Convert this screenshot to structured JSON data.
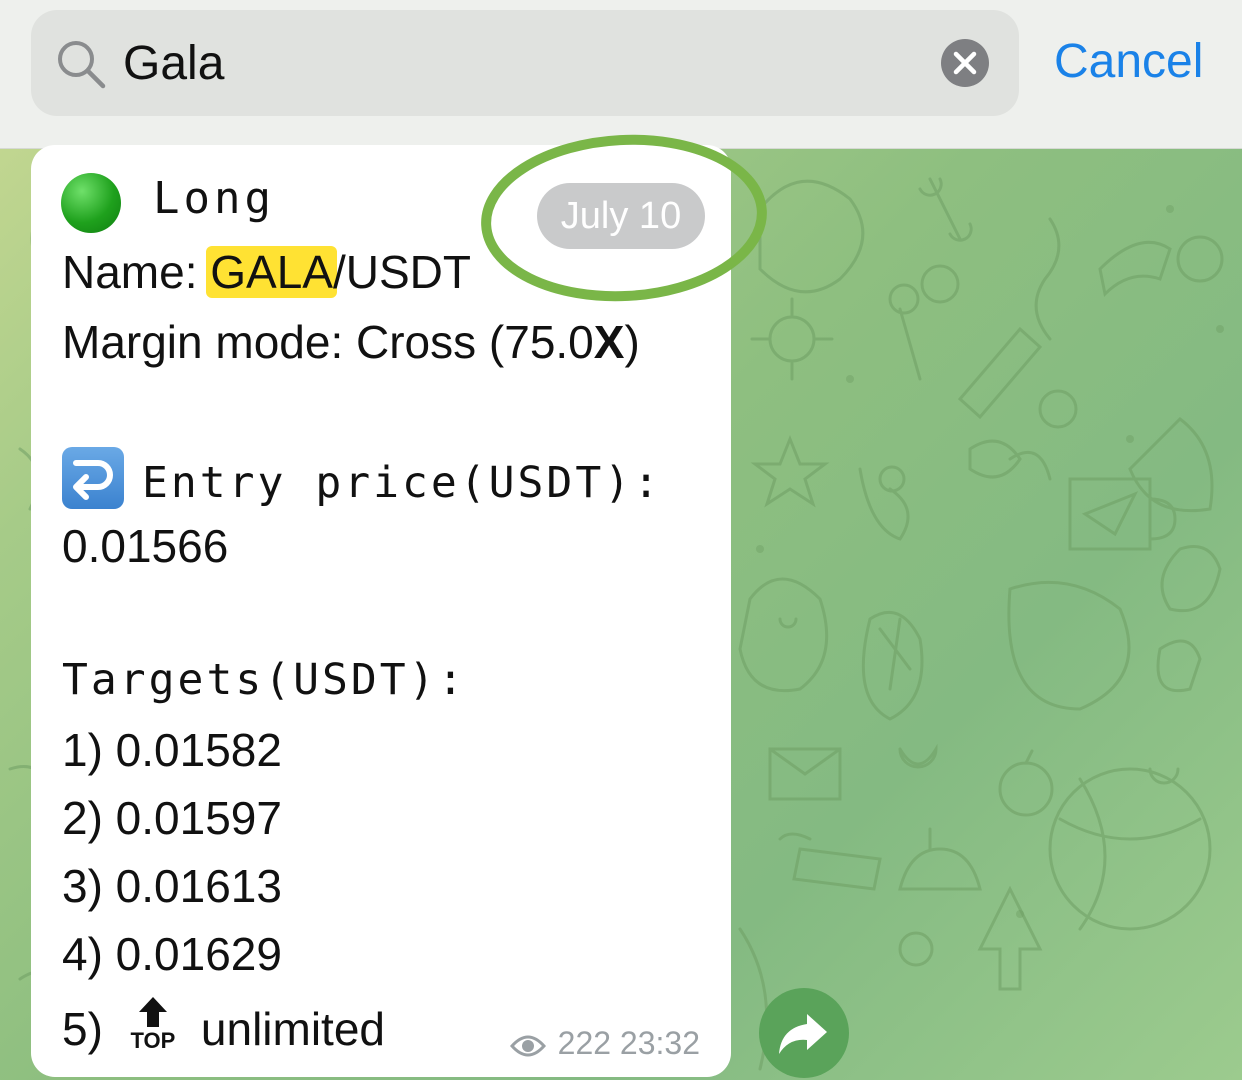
{
  "search": {
    "value": "Gala",
    "cancel_label": "Cancel"
  },
  "message": {
    "direction_emoji": "green-circle",
    "direction": "Long",
    "name_label": "Name: ",
    "name_highlight": "GALA",
    "name_rest": "/USDT",
    "margin_label": "Margin mode: Cross (75.0",
    "margin_x": "X",
    "margin_close": ")",
    "entry_icon": "right-arrow-curving-left-emoji",
    "entry_label": "Entry price(USDT):",
    "entry_value": "0.01566",
    "targets_label": "Targets(USDT):",
    "targets": [
      "1) 0.01582",
      "2) 0.01597",
      "3) 0.01613",
      "4) 0.01629"
    ],
    "target5_prefix": "5)",
    "target5_icon_text": "TOP",
    "target5_value": "unlimited",
    "views": "222",
    "time": "23:32"
  },
  "date_badge": "July 10",
  "colors": {
    "accent": "#1a82e8",
    "highlight": "#ffe233",
    "annotation_green": "#7ab648",
    "bubble": "#ffffff",
    "chat_bg": "#8ebf80"
  },
  "icons": [
    "search-icon",
    "clear-icon",
    "eye-icon",
    "share-icon",
    "top-arrow-icon"
  ]
}
